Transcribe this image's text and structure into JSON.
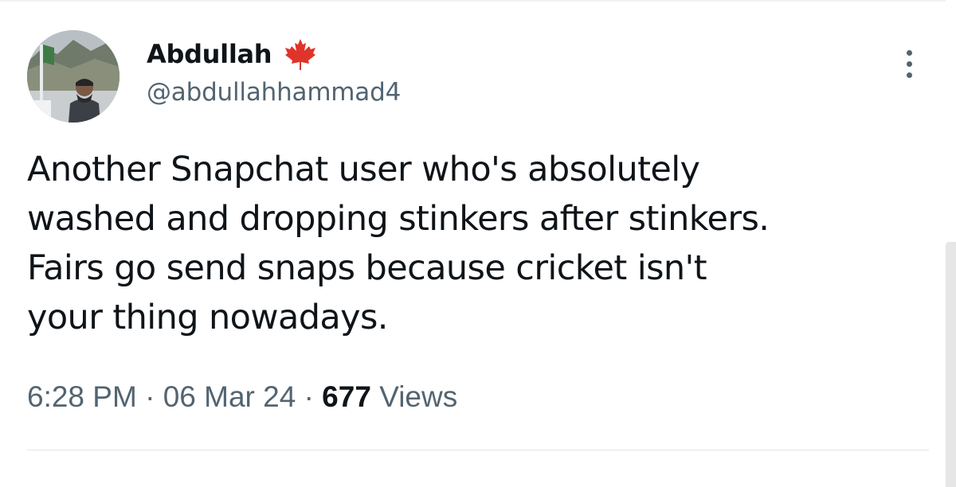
{
  "author": {
    "display_name": "Abdullah",
    "handle": "@abdullahhammad4",
    "badge_icon": "maple-leaf-icon",
    "badge_color": "#e0342b"
  },
  "tweet": {
    "lines": [
      "Another Snapchat user who's absolutely",
      "washed and dropping stinkers after stinkers.",
      "Fairs go send snaps because cricket isn't",
      "your thing nowadays."
    ]
  },
  "meta": {
    "time": "6:28 PM",
    "separator": "·",
    "date": "06 Mar 24",
    "views_count": "677",
    "views_label": "Views"
  },
  "colors": {
    "text_primary": "#0f1419",
    "text_secondary": "#536471"
  },
  "icons": {
    "more": "more-dots-icon"
  }
}
